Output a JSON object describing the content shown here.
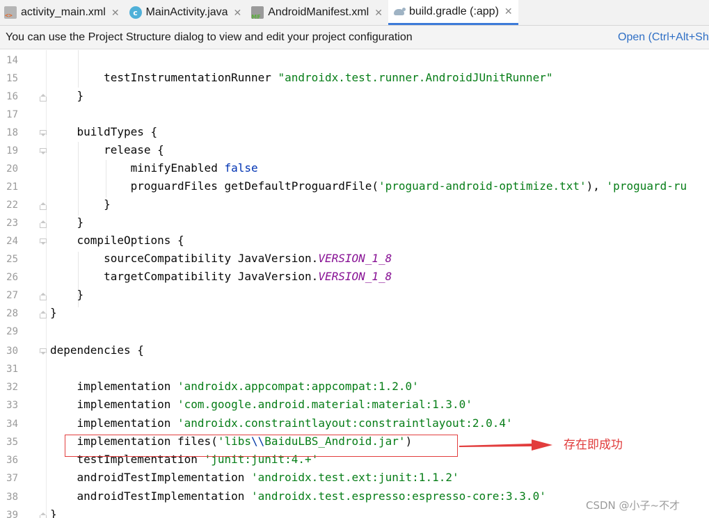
{
  "tabs": [
    {
      "label": "activity_main.xml",
      "icon": "xml-layout-icon",
      "active": false
    },
    {
      "label": "MainActivity.java",
      "icon": "java-class-icon",
      "active": false
    },
    {
      "label": "AndroidManifest.xml",
      "icon": "manifest-icon",
      "active": false
    },
    {
      "label": "build.gradle (:app)",
      "icon": "gradle-icon",
      "active": true
    }
  ],
  "notification": {
    "message": "You can use the Project Structure dialog to view and edit your project configuration",
    "action": "Open (Ctrl+Alt+Sh"
  },
  "editor": {
    "lines": [
      {
        "num": "14",
        "text": ""
      },
      {
        "num": "15",
        "pre": "        testInstrumentationRunner ",
        "str": "\"androidx.test.runner.AndroidJUnitRunner\""
      },
      {
        "num": "16",
        "text": "    }"
      },
      {
        "num": "17",
        "text": ""
      },
      {
        "num": "18",
        "text": "    buildTypes {"
      },
      {
        "num": "19",
        "text": "        release {"
      },
      {
        "num": "20",
        "pre": "            minifyEnabled ",
        "kw": "false"
      },
      {
        "num": "21",
        "pre": "            proguardFiles getDefaultProguardFile(",
        "str1": "'proguard-android-optimize.txt'",
        "mid": "), ",
        "str2": "'proguard-ru"
      },
      {
        "num": "22",
        "text": "        }"
      },
      {
        "num": "23",
        "text": "    }"
      },
      {
        "num": "24",
        "text": "    compileOptions {"
      },
      {
        "num": "25",
        "pre": "        sourceCompatibility JavaVersion.",
        "const": "VERSION_1_8"
      },
      {
        "num": "26",
        "pre": "        targetCompatibility JavaVersion.",
        "const": "VERSION_1_8"
      },
      {
        "num": "27",
        "text": "    }"
      },
      {
        "num": "28",
        "text": "}"
      },
      {
        "num": "29",
        "text": ""
      },
      {
        "num": "30",
        "text": "dependencies {"
      },
      {
        "num": "31",
        "text": ""
      },
      {
        "num": "32",
        "pre": "    implementation ",
        "str": "'androidx.appcompat:appcompat:1.2.0'"
      },
      {
        "num": "33",
        "pre": "    implementation ",
        "str": "'com.google.android.material:material:1.3.0'"
      },
      {
        "num": "34",
        "pre": "    implementation ",
        "str": "'androidx.constraintlayout:constraintlayout:2.0.4'"
      },
      {
        "num": "35",
        "pre": "    implementation files(",
        "s_a": "'libs",
        "s_esc": "\\\\",
        "s_b": "BaiduLBS_Android.jar'",
        "post": ")"
      },
      {
        "num": "36",
        "pre": "    testImplementation ",
        "str": "'junit:junit:4.+'"
      },
      {
        "num": "37",
        "pre": "    androidTestImplementation ",
        "str": "'androidx.test.ext:junit:1.1.2'"
      },
      {
        "num": "38",
        "pre": "    androidTestImplementation ",
        "str": "'androidx.test.espresso:espresso-core:3.3.0'"
      },
      {
        "num": "39",
        "text": "}"
      }
    ]
  },
  "annotation": {
    "text": "存在即成功",
    "color": "#e03b3b"
  },
  "watermark": "CSDN @小子~不才"
}
